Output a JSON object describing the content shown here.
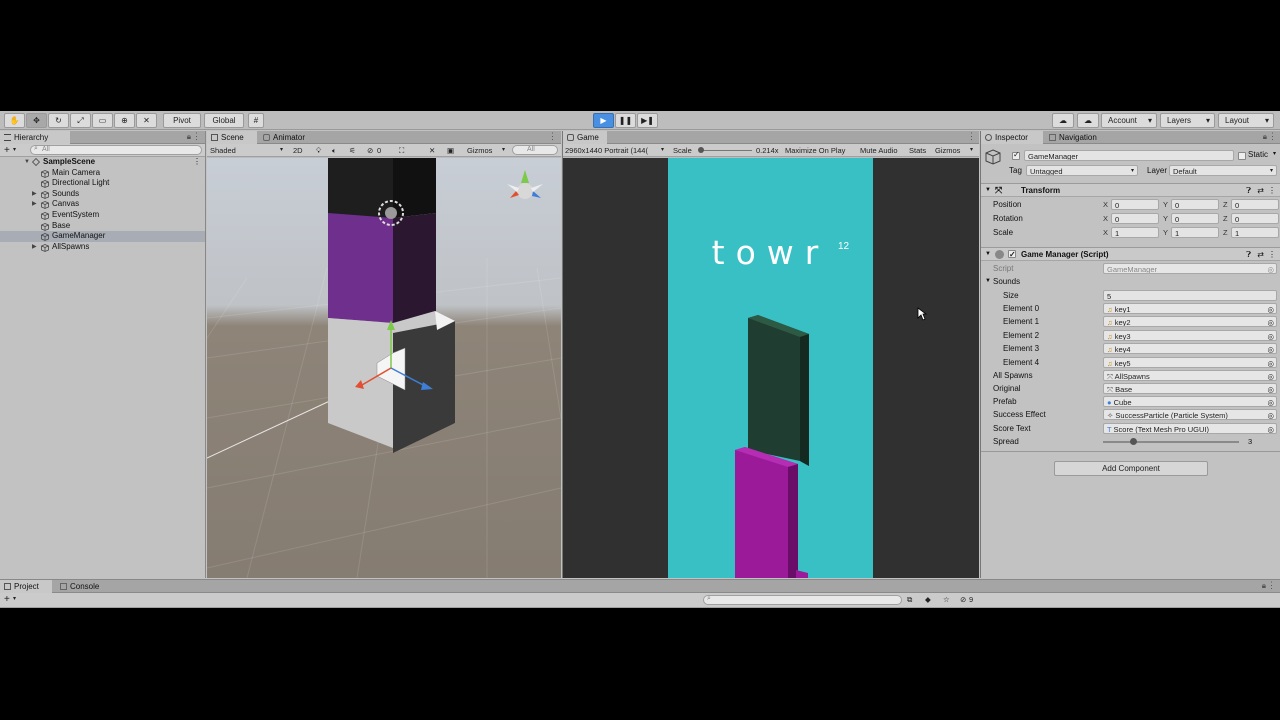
{
  "toolbar": {
    "tools": [
      "hand-tool",
      "move-tool",
      "rotate-tool",
      "scale-tool",
      "rect-tool",
      "transform-tool",
      "custom-tool"
    ],
    "pivot_label": "Pivot",
    "global_label": "Global",
    "account_label": "Account",
    "layers_label": "Layers",
    "layout_label": "Layout"
  },
  "hierarchy": {
    "tab_label": "Hierarchy",
    "search_placeholder": "All",
    "add_label": "+",
    "scene_name": "SampleScene",
    "items": [
      {
        "label": "Main Camera",
        "expandable": false
      },
      {
        "label": "Directional Light",
        "expandable": false
      },
      {
        "label": "Sounds",
        "expandable": true
      },
      {
        "label": "Canvas",
        "expandable": true
      },
      {
        "label": "EventSystem",
        "expandable": false
      },
      {
        "label": "Base",
        "expandable": false
      },
      {
        "label": "GameManager",
        "expandable": false,
        "selected": true
      },
      {
        "label": "AllSpawns",
        "expandable": true
      }
    ]
  },
  "scene": {
    "tab_label": "Scene",
    "animator_tab_label": "Animator",
    "shading_mode": "Shaded",
    "mode_2d": "2D",
    "hidden_count": "0",
    "gizmos_label": "Gizmos",
    "search_placeholder": "All"
  },
  "game": {
    "tab_label": "Game",
    "resolution": "2960x1440 Portrait (144(",
    "scale_label": "Scale",
    "scale_value": "0.214x",
    "maximize_label": "Maximize On Play",
    "mute_label": "Mute Audio",
    "stats_label": "Stats",
    "gizmos_label": "Gizmos",
    "title": "towr",
    "score": "12"
  },
  "inspector": {
    "tab_label": "Inspector",
    "nav_tab_label": "Navigation",
    "object_name": "GameManager",
    "static_label": "Static",
    "tag_label": "Tag",
    "tag_value": "Untagged",
    "layer_label": "Layer",
    "layer_value": "Default",
    "transform": {
      "title": "Transform",
      "position_label": "Position",
      "rotation_label": "Rotation",
      "scale_label": "Scale",
      "position": {
        "x": "0",
        "y": "0",
        "z": "0"
      },
      "rotation": {
        "x": "0",
        "y": "0",
        "z": "0"
      },
      "scale": {
        "x": "1",
        "y": "1",
        "z": "1"
      }
    },
    "script": {
      "title": "Game Manager (Script)",
      "script_label": "Script",
      "script_value": "GameManager",
      "sounds_label": "Sounds",
      "size_label": "Size",
      "size_value": "5",
      "elements": [
        {
          "label": "Element 0",
          "value": "key1"
        },
        {
          "label": "Element 1",
          "value": "key2"
        },
        {
          "label": "Element 2",
          "value": "key3"
        },
        {
          "label": "Element 3",
          "value": "key4"
        },
        {
          "label": "Element 4",
          "value": "key5"
        }
      ],
      "fields": [
        {
          "label": "All Spawns",
          "value": "AllSpawns"
        },
        {
          "label": "Original",
          "value": "Base"
        },
        {
          "label": "Prefab",
          "value": "Cube"
        },
        {
          "label": "Success Effect",
          "value": "SuccessParticle (Particle System)"
        },
        {
          "label": "Score Text",
          "value": "Score (Text Mesh Pro UGUI)"
        }
      ],
      "spread_label": "Spread",
      "spread_value": "3",
      "spread_fraction": 0.22
    },
    "add_component_label": "Add Component"
  },
  "bottom": {
    "project_tab_label": "Project",
    "console_tab_label": "Console",
    "add_label": "+",
    "hidden_count": "9"
  },
  "colors": {
    "game_bg": "#38c0c4",
    "tower_top": "#1f3d30",
    "tower_base": "#9b1a9a",
    "play_accent": "#4a90e2"
  }
}
